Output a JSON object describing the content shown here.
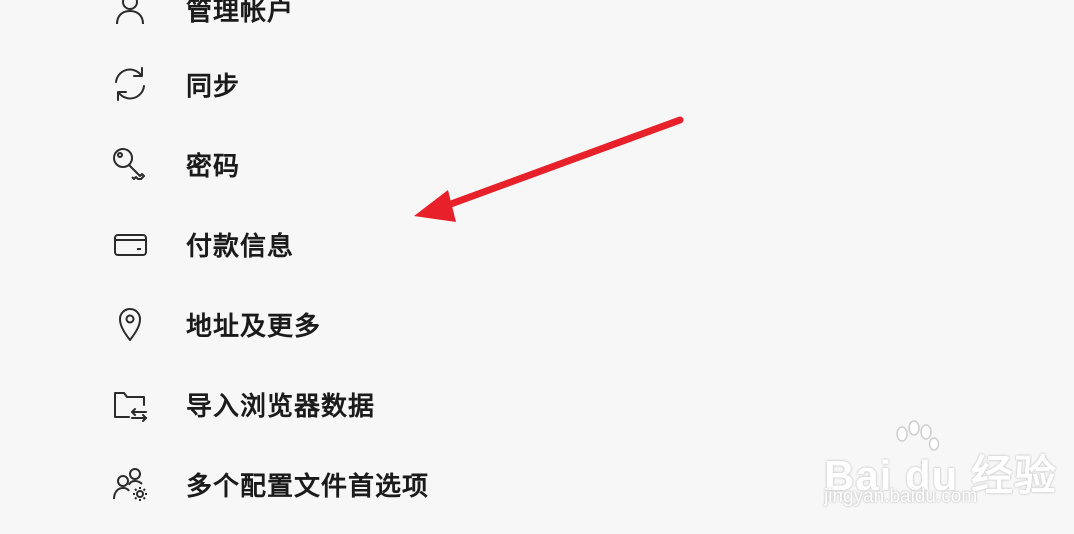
{
  "menu": {
    "items": [
      {
        "label": "管理帐户",
        "icon": "person-icon"
      },
      {
        "label": "同步",
        "icon": "sync-icon"
      },
      {
        "label": "密码",
        "icon": "key-icon"
      },
      {
        "label": "付款信息",
        "icon": "credit-card-icon"
      },
      {
        "label": "地址及更多",
        "icon": "location-pin-icon"
      },
      {
        "label": "导入浏览器数据",
        "icon": "folder-import-icon"
      },
      {
        "label": "多个配置文件首选项",
        "icon": "profiles-settings-icon"
      }
    ]
  },
  "colors": {
    "background": "#f7f7f7",
    "text": "#1b1b1b",
    "icon": "#2b2b2b",
    "arrow": "#e8202a"
  },
  "watermark": {
    "logo": "Bai du 经验",
    "url": "jingyan.baidu.com"
  }
}
